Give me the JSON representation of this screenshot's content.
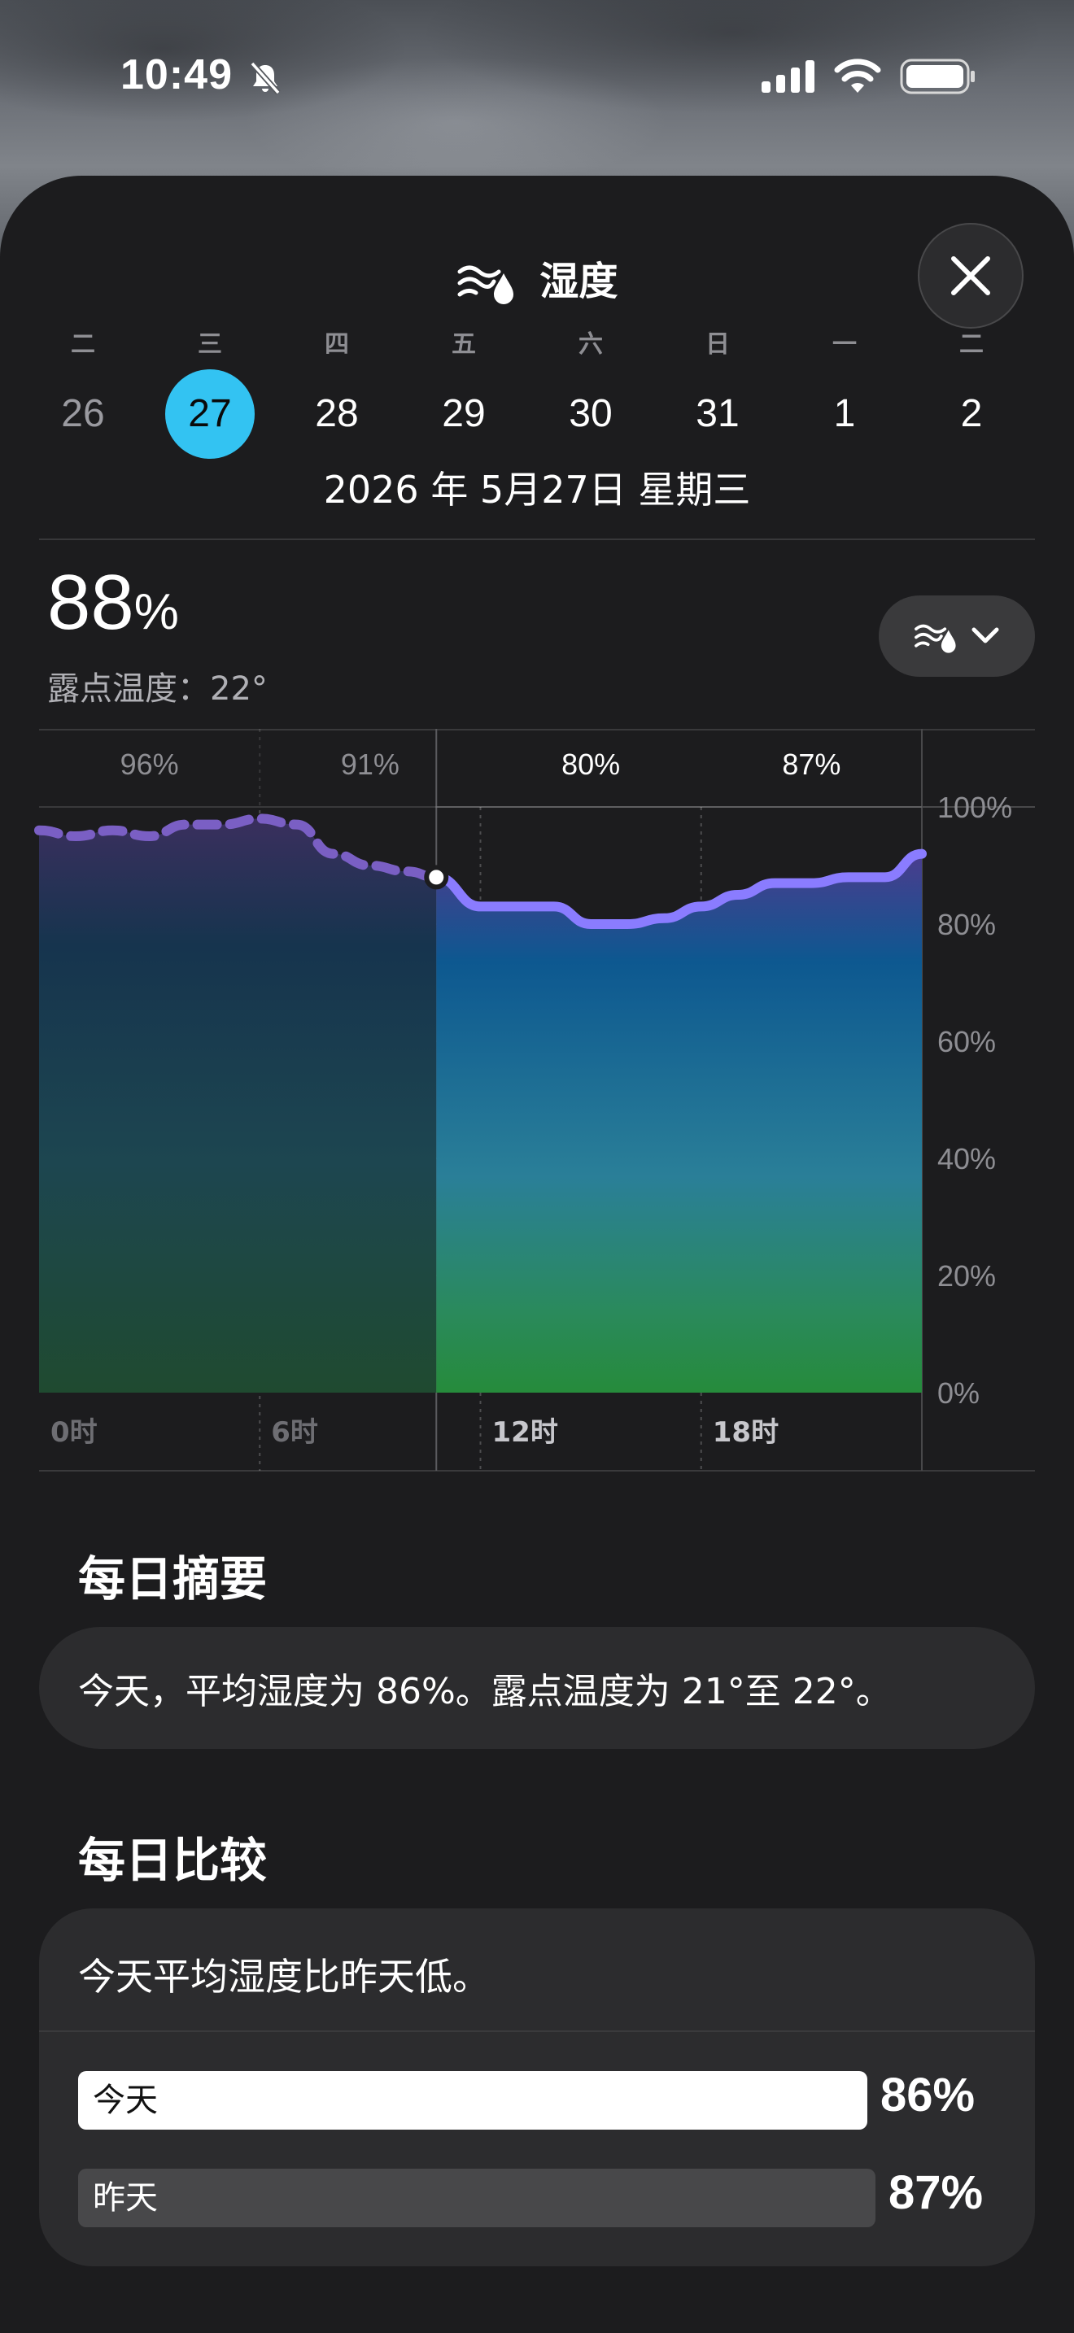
{
  "status_bar": {
    "time": "10:49",
    "icons": [
      "bell-slash-icon",
      "cellular-signal-icon",
      "wifi-icon",
      "battery-icon"
    ]
  },
  "sheet": {
    "title": "湿度",
    "title_icon": "humidity-icon",
    "close_icon": "close-icon"
  },
  "calendar": {
    "weekdays": [
      "二",
      "三",
      "四",
      "五",
      "六",
      "日",
      "一",
      "二"
    ],
    "dates": [
      "26",
      "27",
      "28",
      "29",
      "30",
      "31",
      "1",
      "2"
    ],
    "selected_index": 1,
    "full_date": "2026 年 5月27日 星期三"
  },
  "current": {
    "value": "88",
    "unit": "%",
    "dew_point": "露点温度：22°",
    "mode_button_icon": "humidity-icon",
    "mode_button_chevron": "chevron-down-icon"
  },
  "chart_data": {
    "type": "area",
    "header_values": [
      "96%",
      "91%",
      "80%",
      "87%"
    ],
    "x_ticks": [
      "0时",
      "6时",
      "12时",
      "18时"
    ],
    "y_ticks": [
      "100%",
      "80%",
      "60%",
      "40%",
      "20%",
      "0%"
    ],
    "ylim": [
      0,
      100
    ],
    "xlim": [
      0,
      24
    ],
    "current_hour": 10.8,
    "current_value": 88,
    "series": [
      {
        "x": [
          0,
          1,
          2,
          3,
          4,
          5,
          6,
          7,
          8,
          9,
          10,
          10.8
        ],
        "y": [
          96,
          95,
          96,
          95,
          97,
          97,
          98,
          97,
          92,
          90,
          89,
          88
        ],
        "style": "dashed"
      },
      {
        "x": [
          10.8,
          12,
          13,
          14,
          15,
          16,
          17,
          18,
          19,
          20,
          21,
          22,
          23,
          24
        ],
        "y": [
          88,
          83,
          83,
          83,
          80,
          80,
          81,
          83,
          85,
          87,
          87,
          88,
          88,
          92
        ],
        "style": "solid"
      }
    ],
    "colors": {
      "line": "#8a7cff",
      "past_line": "#7a5fc4"
    }
  },
  "summary": {
    "title": "每日摘要",
    "text": "今天，平均湿度为 86%。露点温度为 21°至 22°。"
  },
  "comparison": {
    "title": "每日比较",
    "text": "今天平均湿度比昨天低。",
    "today_label": "今天",
    "today_value": "86%",
    "yesterday_label": "昨天",
    "yesterday_value": "87%"
  }
}
